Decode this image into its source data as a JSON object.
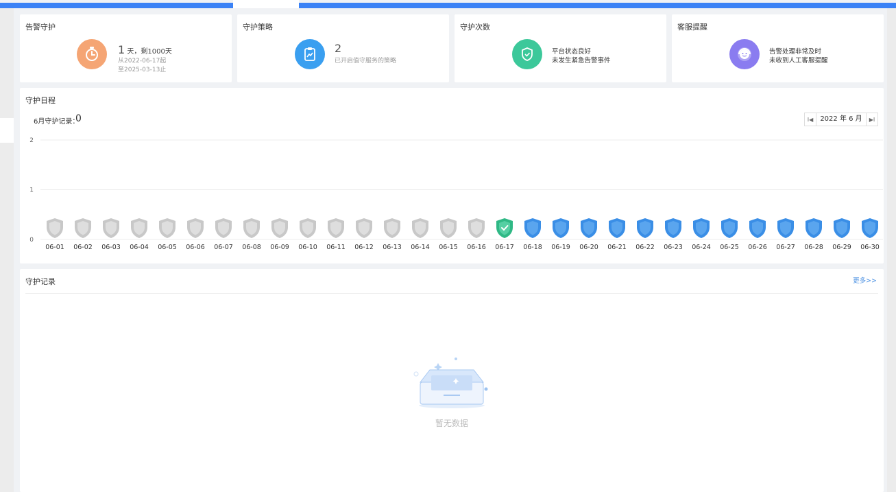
{
  "colors": {
    "accent": "#3b82f6",
    "orange": "#f5a574",
    "blue": "#3a9ff0",
    "green": "#3cc89a",
    "purple": "#8a7cf0",
    "shield_gray": "#c8c8c8",
    "shield_blue": "#3a8ee6",
    "shield_green": "#2fb885"
  },
  "cards": {
    "alert_guard": {
      "title": "告警守护",
      "icon": "stopwatch-icon",
      "main_number": "1",
      "main_suffix": " 天，剩1000天",
      "line1": "从2022-06-17起",
      "line2": "至2025-03-13止"
    },
    "guard_strategy": {
      "title": "守护策略",
      "icon": "clipboard-chart-icon",
      "main_number": "2",
      "line1": "已开启值守服务的策略"
    },
    "guard_count": {
      "title": "守护次数",
      "icon": "shield-check-icon",
      "line1": "平台状态良好",
      "line2": "未发生紧急告警事件"
    },
    "service_reminder": {
      "title": "客服提醒",
      "icon": "customer-service-icon",
      "line1": "告警处理非常及时",
      "line2": "未收到人工客服提醒"
    }
  },
  "schedule": {
    "title": "守护日程",
    "record_label": "6月守护记录：",
    "record_count": "0",
    "month_nav": {
      "prev_label": "I◀",
      "current": "2022 年 6 月",
      "next_label": "▶I"
    }
  },
  "chart_data": {
    "type": "scatter",
    "x": [
      "06-01",
      "06-02",
      "06-03",
      "06-04",
      "06-05",
      "06-06",
      "06-07",
      "06-08",
      "06-09",
      "06-10",
      "06-11",
      "06-12",
      "06-13",
      "06-14",
      "06-15",
      "06-16",
      "06-17",
      "06-18",
      "06-19",
      "06-20",
      "06-21",
      "06-22",
      "06-23",
      "06-24",
      "06-25",
      "06-26",
      "06-27",
      "06-28",
      "06-29",
      "06-30"
    ],
    "values": [
      0,
      0,
      0,
      0,
      0,
      0,
      0,
      0,
      0,
      0,
      0,
      0,
      0,
      0,
      0,
      0,
      0,
      0,
      0,
      0,
      0,
      0,
      0,
      0,
      0,
      0,
      0,
      0,
      0,
      0
    ],
    "status": [
      "past",
      "past",
      "past",
      "past",
      "past",
      "past",
      "past",
      "past",
      "past",
      "past",
      "past",
      "past",
      "past",
      "past",
      "past",
      "past",
      "today",
      "future",
      "future",
      "future",
      "future",
      "future",
      "future",
      "future",
      "future",
      "future",
      "future",
      "future",
      "future",
      "future"
    ],
    "yticks": [
      "0",
      "1",
      "2"
    ],
    "ylim": [
      0,
      2
    ],
    "grid": true,
    "xlabel": "",
    "ylabel": ""
  },
  "records": {
    "title": "守护记录",
    "more_label": "更多>>",
    "empty_text": "暂无数据"
  }
}
